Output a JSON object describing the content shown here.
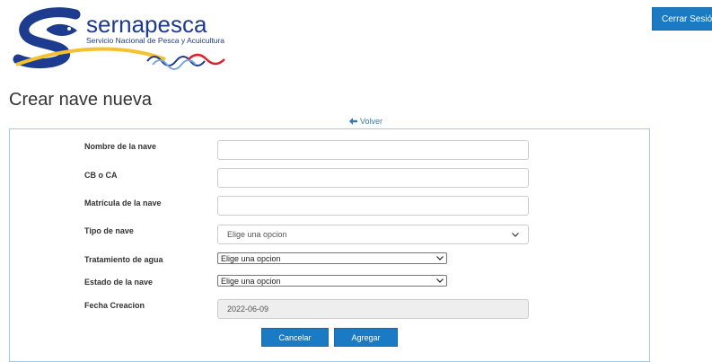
{
  "header": {
    "brand_name": "sernapesca",
    "brand_tagline": "Servicio Nacional de Pesca y Acuicultura",
    "logout_label": "Cerrar Sesión"
  },
  "page": {
    "title": "Crear nave nueva",
    "back_label": "Volver"
  },
  "form": {
    "fields": [
      {
        "label": "Nombre de la nave",
        "value": ""
      },
      {
        "label": "CB o CA",
        "value": ""
      },
      {
        "label": "Matrícula de la nave",
        "value": ""
      },
      {
        "label": "Tipo de nave",
        "selected": "Elige una opcion"
      },
      {
        "label": "Tratamiento de agua",
        "selected": "Elige una opcion"
      },
      {
        "label": "Estado de la nave",
        "selected": "Elige una opcion"
      },
      {
        "label": "Fecha Creacion",
        "value": "2022-06-09"
      }
    ],
    "cancel_label": "Cancelar",
    "submit_label": "Agregar"
  },
  "colors": {
    "primary": "#1a7bc4",
    "panel_border": "#9ec9ea",
    "link": "#337ab7",
    "logo_blue": "#1d3b8f",
    "logo_yellow": "#f2c230",
    "logo_red": "#d8262e"
  }
}
